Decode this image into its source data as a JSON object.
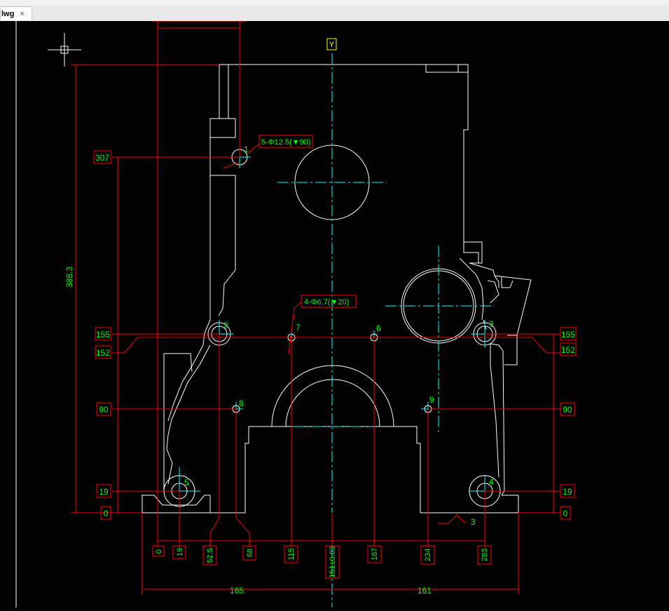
{
  "tab": {
    "label": "lwg",
    "close": "×"
  },
  "colors": {
    "outline": "#ffffff",
    "dimension": "#ff0000",
    "center": "#00ffff",
    "text": "#00ff00",
    "tag": "#ffff00"
  },
  "axis_tag": "Y",
  "notes": {
    "holes_large": "5-Φ12.5(▼90)",
    "holes_small": "4-Φ6.7(▼20)"
  },
  "hole_labels": [
    "1",
    "2",
    "3",
    "4",
    "5",
    "6",
    "7",
    "8",
    "9"
  ],
  "left_dims": [
    "307",
    "155",
    "152",
    "90",
    "19",
    "0"
  ],
  "right_dims": [
    "155",
    "152",
    "90",
    "19",
    "0"
  ],
  "vertical_total": "388.3",
  "bottom_dims": [
    "0",
    "19",
    "52.5",
    "68",
    "115",
    "151±0.03",
    "187",
    "234",
    "283"
  ],
  "span_left": "165",
  "span_right": "161",
  "corner_mark": "3"
}
